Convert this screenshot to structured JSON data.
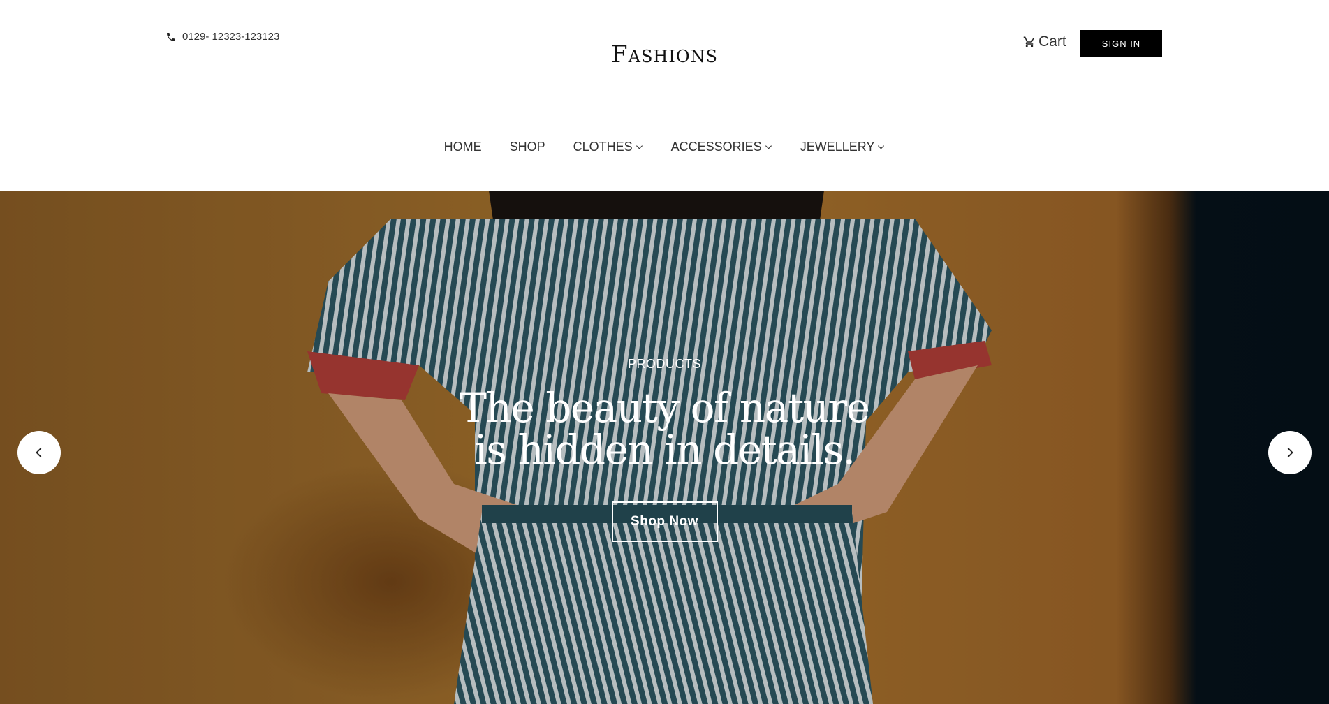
{
  "header": {
    "phone": "0129- 12323-123123",
    "logo": "Fashions",
    "cart_label": "Cart",
    "signin_label": "SIGN IN"
  },
  "nav": {
    "items": [
      {
        "label": "HOME",
        "has_dropdown": false
      },
      {
        "label": "SHOP",
        "has_dropdown": false
      },
      {
        "label": "CLOTHES",
        "has_dropdown": true
      },
      {
        "label": "ACCESSORIES",
        "has_dropdown": true
      },
      {
        "label": "JEWELLERY",
        "has_dropdown": true
      }
    ]
  },
  "hero": {
    "eyebrow": "PRODUCTS",
    "headline_line1": "The beauty of nature",
    "headline_line2": "is hidden in details.",
    "cta_label": "Shop Now",
    "prev_icon": "chevron-left-icon",
    "next_icon": "chevron-right-icon"
  },
  "colors": {
    "signin_bg": "#000000",
    "hero_wall": "#a8732d",
    "hero_dark": "#07131b",
    "stripe_blue": "#2f5a66"
  }
}
